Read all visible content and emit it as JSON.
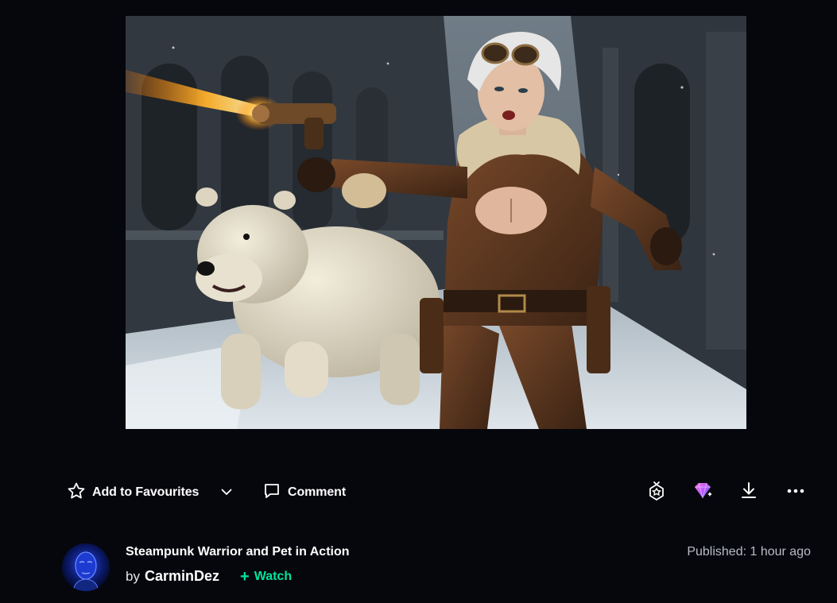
{
  "artwork": {
    "alt_subject": "steampunk-warrior-with-polar-bear"
  },
  "actions": {
    "favourite_label": "Add to Favourites",
    "comment_label": "Comment",
    "icons": [
      "star-icon",
      "chevron-down-icon",
      "comment-icon",
      "badge-gift-icon",
      "core-gem-icon",
      "download-icon",
      "more-icon"
    ]
  },
  "deviation": {
    "title": "Steampunk Warrior and Pet in Action",
    "by_prefix": "by",
    "author": "CarminDez",
    "watch_label": "Watch",
    "published_label": "Published:",
    "published_value": "1 hour ago"
  },
  "colors": {
    "background": "#06070d",
    "watch_green": "#00e59b",
    "muted_text": "#b8bcc4"
  }
}
